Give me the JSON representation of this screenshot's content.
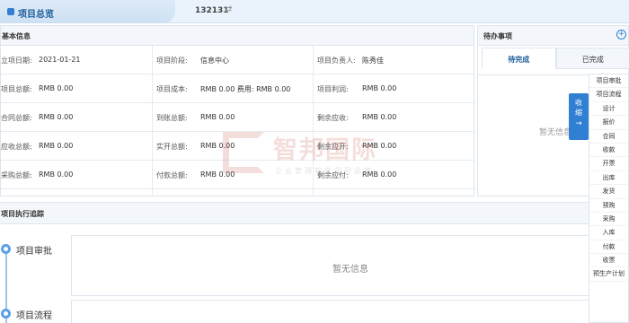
{
  "header": {
    "tab_title": "项目总览",
    "project_no": "132131",
    "swap_icon": "⇄"
  },
  "basic_info": {
    "title": "基本信息",
    "rows": [
      {
        "l1": "立项日期:",
        "v1": "2021-01-21",
        "l2": "项目阶段:",
        "v2": "信息中心",
        "l3": "项目负责人:",
        "v3": "陈秀佳"
      },
      {
        "l1": "项目总额:",
        "v1": "RMB 0.00",
        "l2": "项目成本:",
        "v2": "RMB 0.00  费用:  RMB 0.00",
        "l3": "项目利润:",
        "v3": "RMB 0.00"
      },
      {
        "l1": "合同总额:",
        "v1": "RMB 0.00",
        "l2": "到账总额:",
        "v2": "RMB 0.00",
        "l3": "剩余应收:",
        "v3": "RMB 0.00"
      },
      {
        "l1": "应收总额:",
        "v1": "RMB 0.00",
        "l2": "实开总额:",
        "v2": "RMB 0.00",
        "l3": "剩余应开:",
        "v3": "RMB 0.00"
      },
      {
        "l1": "采购总额:",
        "v1": "RMB 0.00",
        "l2": "付款总额:",
        "v2": "RMB 0.00",
        "l3": "剩余应付:",
        "v3": "RMB 0.00"
      }
    ]
  },
  "todo": {
    "title": "待办事项",
    "tabs": [
      "待完成",
      "已完成"
    ],
    "empty": "暂无信息"
  },
  "tracking": {
    "title": "项目执行追踪",
    "items": [
      "项目审批",
      "项目流程"
    ],
    "empty": "暂无信息"
  },
  "collapse": {
    "label": "收缩",
    "arrow": "→"
  },
  "menu": [
    "项目审批",
    "项目流程",
    "设计",
    "报价",
    "合同",
    "收款",
    "开票",
    "出库",
    "发货",
    "预购",
    "采购",
    "入库",
    "付款",
    "收票",
    "预生产计划"
  ],
  "watermark": {
    "big": "智邦国际",
    "small": "企业管理软件领导品牌"
  }
}
